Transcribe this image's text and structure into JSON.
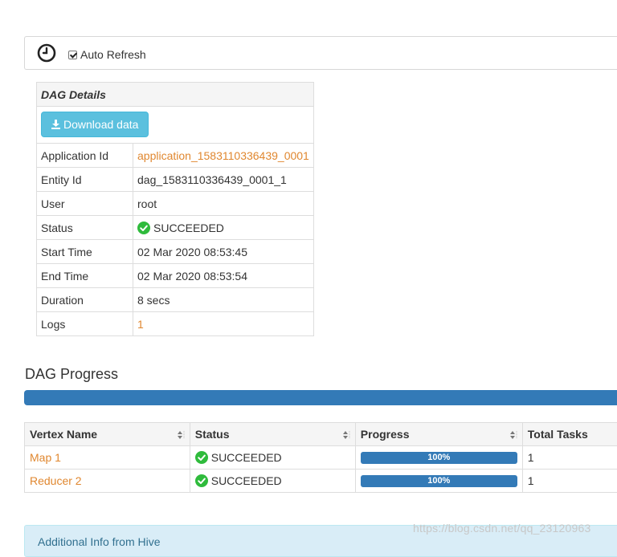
{
  "toolbar": {
    "auto_refresh_label": "Auto Refresh",
    "auto_refresh_checked": true
  },
  "details": {
    "title": "DAG Details",
    "download_label": "Download data",
    "rows": [
      {
        "label": "Application Id",
        "value": "application_1583110336439_0001"
      },
      {
        "label": "Entity Id",
        "value": "dag_1583110336439_0001_1"
      },
      {
        "label": "User",
        "value": "root"
      },
      {
        "label": "Status",
        "value": "SUCCEEDED"
      },
      {
        "label": "Start Time",
        "value": "02 Mar 2020 08:53:45"
      },
      {
        "label": "End Time",
        "value": "02 Mar 2020 08:53:54"
      },
      {
        "label": "Duration",
        "value": "8 secs"
      },
      {
        "label": "Logs",
        "value": "1"
      }
    ]
  },
  "progress": {
    "title": "DAG Progress",
    "value": 1.0
  },
  "vertex_table": {
    "columns": [
      "Vertex Name",
      "Status",
      "Progress",
      "Total Tasks"
    ],
    "rows": [
      {
        "name": "Map 1",
        "status": "SUCCEEDED",
        "progress": "100%",
        "total_tasks": "1"
      },
      {
        "name": "Reducer 2",
        "status": "SUCCEEDED",
        "progress": "100%",
        "total_tasks": "1"
      }
    ]
  },
  "info": {
    "label": "Additional Info from Hive"
  },
  "watermark": "https://blog.csdn.net/qq_23120963",
  "colors": {
    "link": "#e0872f",
    "primary": "#337ab7",
    "info_button": "#5bc0de",
    "success": "#2fbb3c"
  },
  "icons": {
    "clock": "clock-icon",
    "download": "download-icon",
    "status": "check-circle-icon",
    "sort": "sort-icon"
  }
}
